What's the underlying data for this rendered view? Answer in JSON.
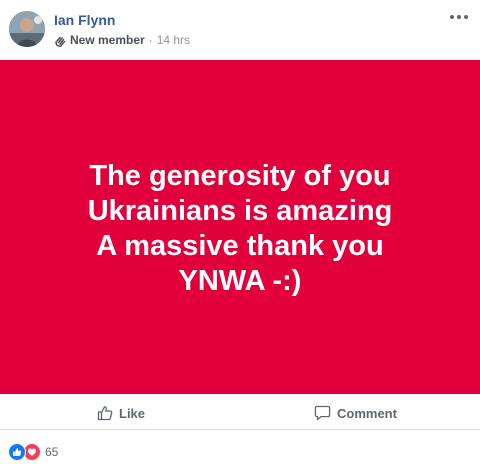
{
  "post": {
    "author": "Ian Flynn",
    "badge": "New member",
    "separator": "·",
    "time": "14 hrs",
    "background_color": "#e2003c",
    "text_lines": [
      "The generosity of you",
      "Ukrainians is amazing",
      "A massive thank you",
      "YNWA -:)"
    ]
  },
  "actions": {
    "like_label": "Like",
    "comment_label": "Comment"
  },
  "reactions": {
    "types": [
      "like-icon",
      "love-icon"
    ],
    "count": "65"
  },
  "icons": {
    "badge": "waving-hand-icon",
    "more": "more-options-icon",
    "like": "thumbs-up-icon",
    "comment": "speech-bubble-icon"
  },
  "colors": {
    "author_link": "#385898",
    "like_reaction": "#1877f2",
    "love_reaction": "#f33e58"
  }
}
